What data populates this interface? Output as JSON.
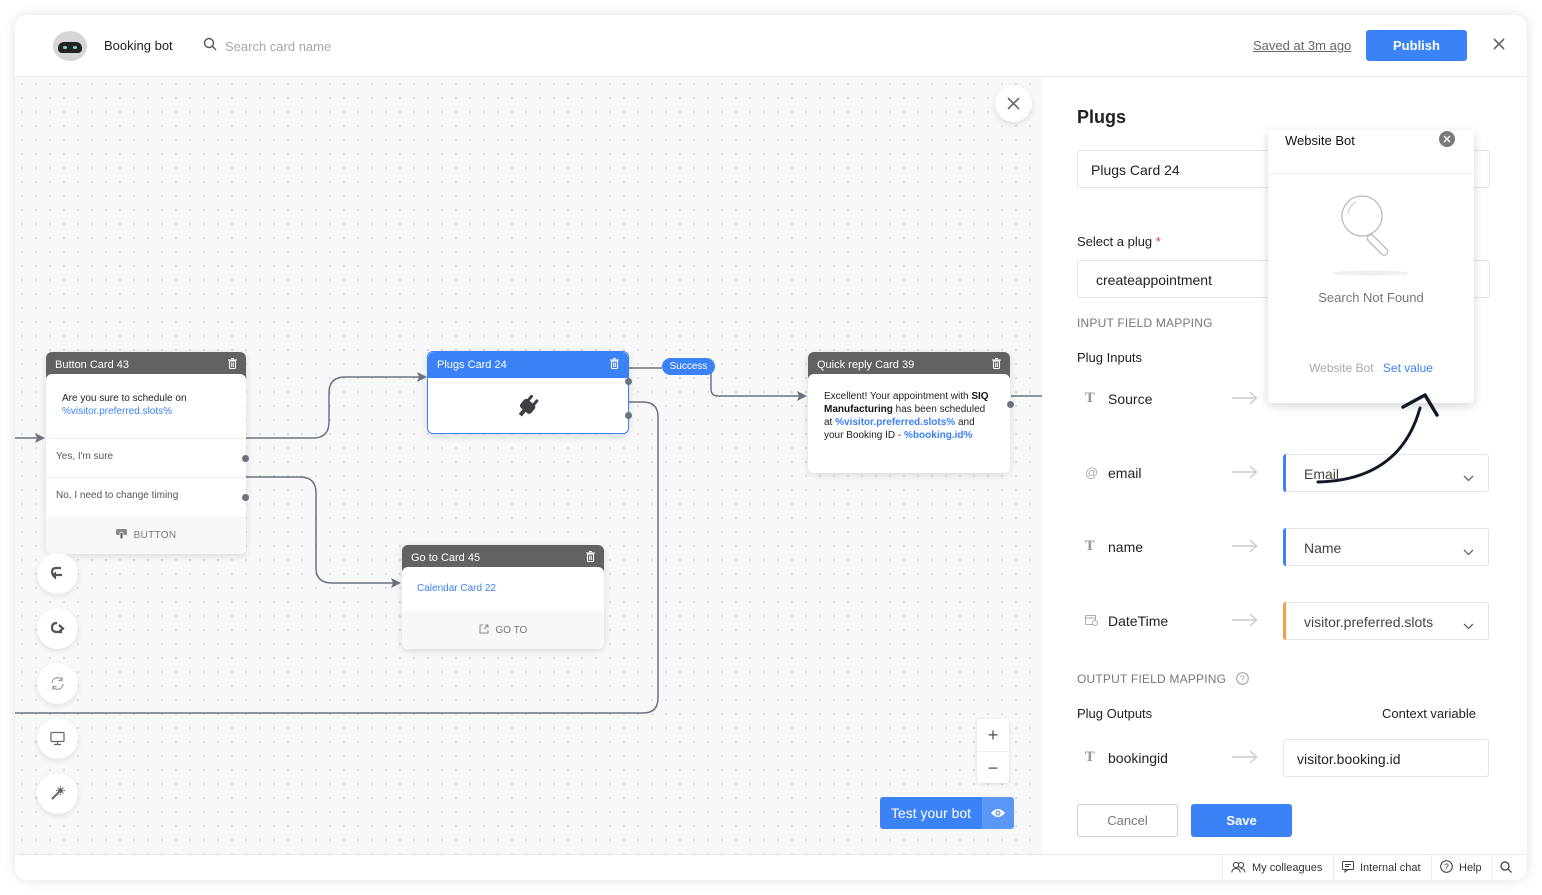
{
  "header": {
    "bot_name": "Booking bot",
    "search_placeholder": "Search card name",
    "saved_status": "Saved at 3m ago",
    "publish_label": "Publish"
  },
  "canvas": {
    "cards": {
      "button_card": {
        "title": "Button Card 43",
        "message_prefix": "Are you sure to schedule on",
        "message_variable": "%visitor.preferred.slots%",
        "options": [
          "Yes, I'm sure",
          "No, I need to change timing"
        ],
        "footer_label": "BUTTON"
      },
      "plugs_card": {
        "title": "Plugs Card 24"
      },
      "success_label": "Success",
      "quick_reply_card": {
        "title": "Quick reply Card 39",
        "text_1": "Excellent! Your appointment with",
        "company": "SIQ Manufacturing",
        "text_2": "has been scheduled at",
        "var_1": "%visitor.preferred.slots%",
        "text_3": "and your Booking ID -",
        "var_2": "%booking.id%"
      },
      "goto_card": {
        "title": "Go to Card 45",
        "target": "Calendar Card 22",
        "footer_label": "GO TO"
      }
    },
    "tools": [
      "undo-icon",
      "redo-icon",
      "refresh-icon",
      "monitor-icon",
      "magic-wand-icon"
    ],
    "zoom_in": "+",
    "zoom_out": "−",
    "test_bot_label": "Test your bot"
  },
  "panel": {
    "title": "Plugs",
    "card_name_value": "Plugs Card 24",
    "select_plug_label": "Select a plug",
    "required_mark": "*",
    "selected_plug": "createappointment",
    "input_mapping_heading": "INPUT FIELD MAPPING",
    "plug_inputs_label": "Plug Inputs",
    "inputs": [
      {
        "icon": "text-type-icon",
        "icon_glyph": "T",
        "name": "Source",
        "value": "",
        "accent": ""
      },
      {
        "icon": "at-icon",
        "icon_glyph": "@",
        "name": "email",
        "value": "Email",
        "accent": "#3b82f6"
      },
      {
        "icon": "text-type-icon",
        "icon_glyph": "T",
        "name": "name",
        "value": "Name",
        "accent": "#3b82f6"
      },
      {
        "icon": "calendar-clock-icon",
        "icon_glyph": "",
        "name": "DateTime",
        "value": "visitor.preferred.slots",
        "accent": "#f59e42"
      }
    ],
    "output_mapping_heading": "OUTPUT FIELD MAPPING",
    "plug_outputs_label": "Plug Outputs",
    "context_variable_label": "Context variable",
    "outputs": [
      {
        "icon": "text-type-icon",
        "icon_glyph": "T",
        "name": "bookingid",
        "value": "visitor.booking.id"
      }
    ],
    "cancel_label": "Cancel",
    "save_label": "Save"
  },
  "popup": {
    "search_value": "Website Bot",
    "empty_text": "Search Not Found",
    "query_echo": "Website Bot",
    "set_value_label": "Set value"
  },
  "footer": {
    "colleagues": "My colleagues",
    "internal_chat": "Internal chat",
    "help": "Help"
  }
}
